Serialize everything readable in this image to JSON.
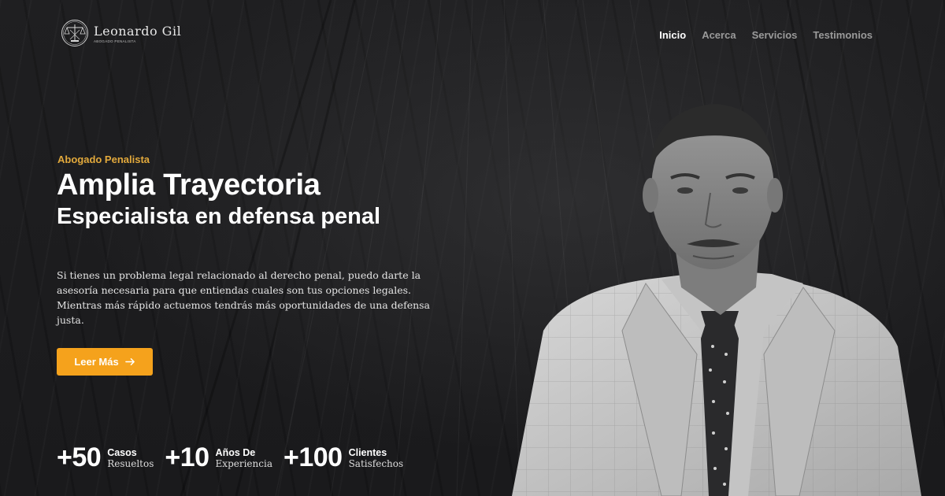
{
  "header": {
    "logo_name": "Leonardo Gil",
    "logo_sub": "ABOGADO PENALISTA",
    "nav": [
      "Inicio",
      "Acerca",
      "Servicios",
      "Testimonios"
    ]
  },
  "hero": {
    "eyebrow": "Abogado Penalista",
    "title": "Amplia Trayectoria",
    "subtitle": "Especialista en defensa penal",
    "description": "Si tienes un problema legal relacionado al derecho penal, puedo darte la asesoría necesaria para que entiendas cuales son tus opciones legales. Mientras más rápido actuemos tendrás más oportunidades de una defensa justa.",
    "cta_label": "Leer Más",
    "cta_icon": "arrow-right-icon"
  },
  "stats": [
    {
      "number": "+50",
      "line1": "Casos",
      "line2": "Resueltos"
    },
    {
      "number": "+10",
      "line1": "Años De",
      "line2": "Experiencia"
    },
    {
      "number": "+100",
      "line1": "Clientes",
      "line2": "Satisfechos"
    }
  ],
  "colors": {
    "accent": "#f5a21c",
    "eyebrow": "#e2a93c",
    "background": "#1c1c1e",
    "nav_inactive": "#9a9a9a"
  }
}
